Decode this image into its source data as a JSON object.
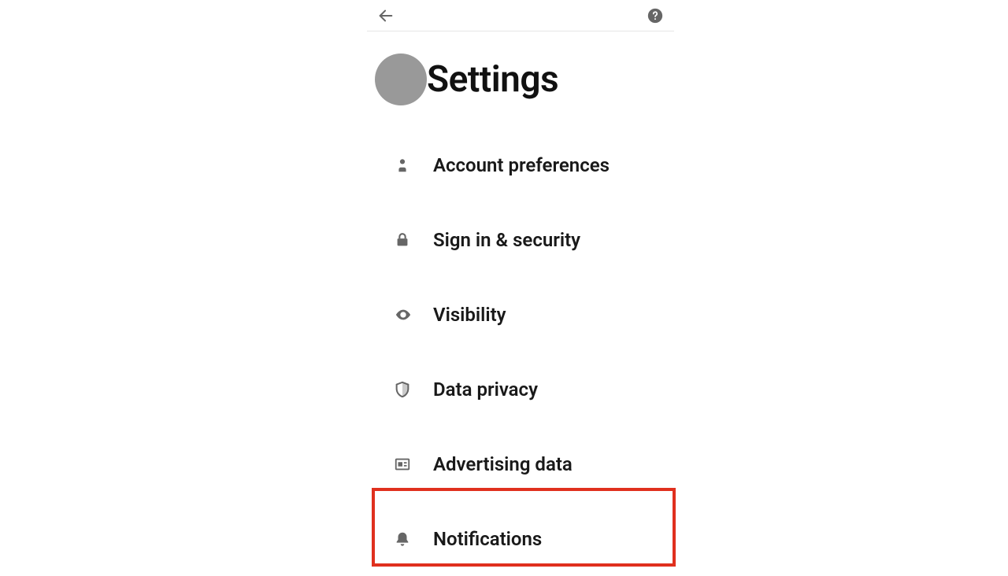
{
  "header": {
    "title": "Settings"
  },
  "menu": {
    "items": [
      {
        "label": "Account preferences",
        "name": "account-preferences",
        "icon": "person-icon"
      },
      {
        "label": "Sign in & security",
        "name": "sign-in-security",
        "icon": "lock-icon"
      },
      {
        "label": "Visibility",
        "name": "visibility",
        "icon": "eye-icon"
      },
      {
        "label": "Data privacy",
        "name": "data-privacy",
        "icon": "shield-icon"
      },
      {
        "label": "Advertising data",
        "name": "advertising-data",
        "icon": "newspaper-icon"
      },
      {
        "label": "Notifications",
        "name": "notifications",
        "icon": "bell-icon"
      }
    ]
  },
  "highlight": {
    "index": 5
  }
}
